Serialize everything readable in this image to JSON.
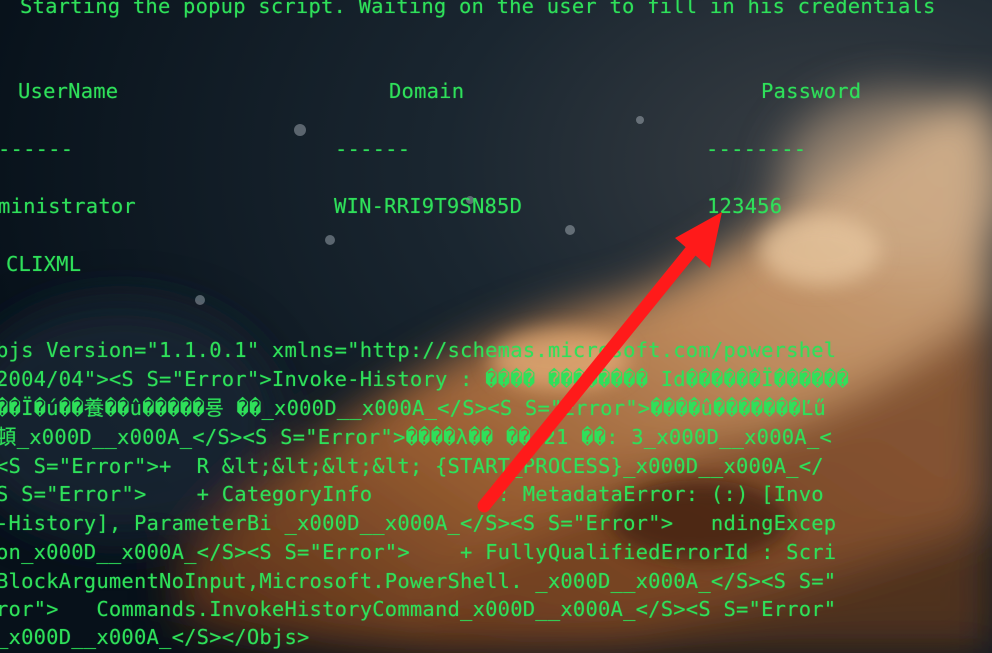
{
  "terminal": {
    "status_line": "Starting the popup script. Waiting on the user to fill in his credentials",
    "headers": {
      "username": "UserName",
      "domain": "Domain",
      "password": "Password"
    },
    "separators": {
      "username": "------",
      "domain": "------",
      "password": "--------"
    },
    "row": {
      "username": "ministrator",
      "domain": "WIN-RRI9T9SN85D",
      "password": "123456"
    },
    "clixml_marker": "CLIXML",
    "clixml_lines": [
      "bjs Version=\"1.1.0.1\" xmlns=\"http://schemas.microsoft.com/powershel",
      "2004/04\"><S S=\"Error\">Invoke-History : ���� �������� Id������Ï������",
      "��Ï�ú��養��û�����룡 ��_x000D__x000A_</S><S S=\"Error\">����û�������Ľű",
      "頓_x000D__x000A_</S><S S=\"Error\">����λ�� ��:21 ��: 3_x000D__x000A_<",
      "<S S=\"Error\">+  R &lt;&lt;&lt;&lt; {START_PROCESS}_x000D__x000A_</",
      "S S=\"Error\">    + CategoryInfo          : MetadataError: (:) [Invo",
      "-History], ParameterBi _x000D__x000A_</S><S S=\"Error\">   ndingExcep",
      "on_x000D__x000A_</S><S S=\"Error\">    + FullyQualifiedErrorId : Scri",
      "BlockArgumentNoInput,Microsoft.PowerShell. _x000D__x000A_</S><S S=\"",
      "ror\">   Commands.InvokeHistoryCommand_x000D__x000A_</S><S S=\"Error\"",
      "_x000D__x000A_</S></Objs>"
    ]
  },
  "annotation": {
    "arrow_color": "#ff1a1a"
  },
  "colors": {
    "terminal_text": "#2fe05a",
    "background": "#0b141c"
  }
}
